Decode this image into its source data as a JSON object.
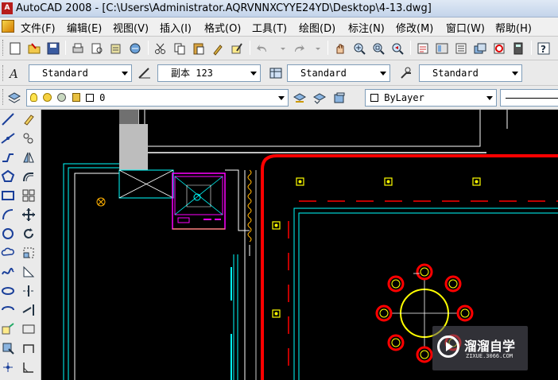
{
  "window": {
    "app_icon_glyph": "A",
    "title": "AutoCAD 2008 - [C:\\Users\\Administrator.AQRVNNXCYYE24YD\\Desktop\\4-13.dwg]"
  },
  "menu": {
    "items": [
      "文件(F)",
      "编辑(E)",
      "视图(V)",
      "插入(I)",
      "格式(O)",
      "工具(T)",
      "绘图(D)",
      "标注(N)",
      "修改(M)",
      "窗口(W)",
      "帮助(H)"
    ]
  },
  "styles_toolbar": {
    "text_style": "Standard",
    "dim_style": "副本 123",
    "table_style": "Standard",
    "multileader_style": "Standard"
  },
  "layers_toolbar": {
    "current_layer": "0",
    "color_control": "ByLayer"
  },
  "watermark": {
    "title": "溜溜自学",
    "subtitle": "ZIXUE.3066.COM"
  },
  "colors": {
    "canvas": "#000000",
    "cyan_lines": "#00ffff",
    "red_lines": "#ff0000",
    "yellow_lines": "#ffff00",
    "magenta_lines": "#ff00ff",
    "white_lines": "#ffffff"
  },
  "icons": {
    "toolbar1": [
      "new-icon",
      "open-icon",
      "save-icon",
      "print-icon",
      "print-preview-icon",
      "publish-icon",
      "plot-icon",
      "cut-icon",
      "copy-icon",
      "paste-icon",
      "match-properties-icon",
      "block-editor-icon",
      "undo-icon",
      "redo-icon",
      "pan-icon",
      "zoom-realtime-icon",
      "zoom-window-icon",
      "zoom-previous-icon",
      "properties-icon",
      "design-center-icon",
      "tool-palettes-icon",
      "sheet-set-icon",
      "markup-icon",
      "quickcalc-icon",
      "help-icon"
    ],
    "palette": [
      "line-icon",
      "construction-line-icon",
      "polyline-icon",
      "polygon-icon",
      "rectangle-icon",
      "arc-icon",
      "circle-icon",
      "revision-cloud-icon",
      "spline-icon",
      "ellipse-icon",
      "ellipse-arc-icon",
      "insert-block-icon",
      "make-block-icon",
      "erase-icon",
      "copy-object-icon",
      "mirror-icon",
      "offset-icon",
      "array-icon",
      "move-icon",
      "rotate-icon",
      "scale-icon",
      "stretch-icon",
      "trim-icon",
      "extend-icon",
      "break-icon"
    ]
  }
}
